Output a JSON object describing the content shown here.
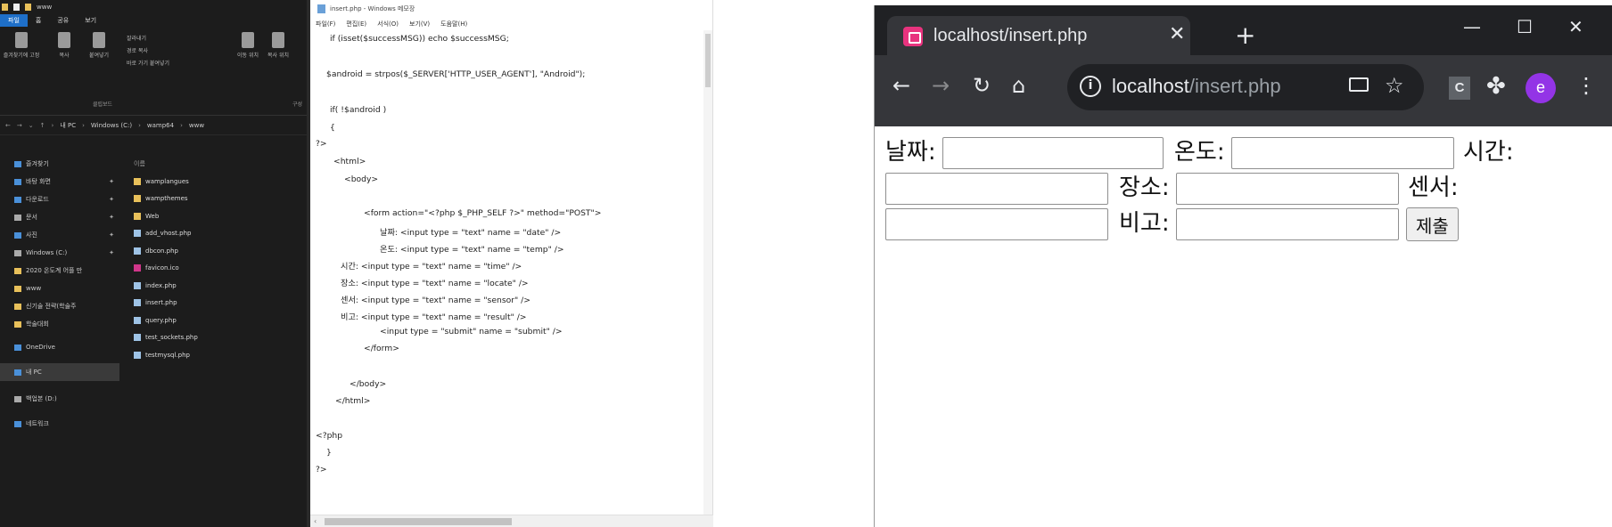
{
  "explorer": {
    "window_title": "www",
    "ribbon_tabs": [
      "파일",
      "홈",
      "공유",
      "보기"
    ],
    "ribbon": {
      "pin_label": "즐겨찾기에 고정",
      "copy_label": "복사",
      "paste_label": "붙여넣기",
      "cut_label": "잘라내기",
      "copy_path_label": "경로 복사",
      "paste_shortcut_label": "바로 가기 붙여넣기",
      "move_label": "이동 위치",
      "copy_to_label": "복사 위치",
      "clipboard_group": "클립보드",
      "organize_group": "구성"
    },
    "address": {
      "segments": [
        "내 PC",
        "Windows (C:)",
        "wamp64",
        "www"
      ]
    },
    "nav_items": [
      {
        "label": "즐겨찾기",
        "icon": "star-icon",
        "pinned": false
      },
      {
        "label": "바탕 화면",
        "icon": "desktop-icon",
        "pinned": true
      },
      {
        "label": "다운로드",
        "icon": "download-icon",
        "pinned": true
      },
      {
        "label": "문서",
        "icon": "document-icon",
        "pinned": true
      },
      {
        "label": "사진",
        "icon": "pictures-icon",
        "pinned": true
      },
      {
        "label": "Windows (C:)",
        "icon": "drive-icon",
        "pinned": true
      },
      {
        "label": "2020 온도계 어플 만",
        "icon": "folder-icon",
        "pinned": false
      },
      {
        "label": "www",
        "icon": "folder-icon",
        "pinned": false
      },
      {
        "label": "신기술 전략(학술주",
        "icon": "folder-icon",
        "pinned": false
      },
      {
        "label": "학술대회",
        "icon": "folder-icon",
        "pinned": false
      },
      {
        "label": "OneDrive",
        "icon": "cloud-icon",
        "pinned": false
      },
      {
        "label": "내 PC",
        "icon": "pc-icon",
        "pinned": false
      },
      {
        "label": "백업본 (D:)",
        "icon": "drive-icon",
        "pinned": false
      },
      {
        "label": "네트워크",
        "icon": "network-icon",
        "pinned": false
      }
    ],
    "files_header": "이름",
    "files": [
      {
        "name": "wamplangues",
        "type": "folder"
      },
      {
        "name": "wampthemes",
        "type": "folder"
      },
      {
        "name": "Web",
        "type": "folder"
      },
      {
        "name": "add_vhost.php",
        "type": "php"
      },
      {
        "name": "dbcon.php",
        "type": "php"
      },
      {
        "name": "favicon.ico",
        "type": "ico"
      },
      {
        "name": "index.php",
        "type": "php"
      },
      {
        "name": "insert.php",
        "type": "php"
      },
      {
        "name": "query.php",
        "type": "php"
      },
      {
        "name": "test_sockets.php",
        "type": "php"
      },
      {
        "name": "testmysql.php",
        "type": "php"
      }
    ]
  },
  "notepad": {
    "title": "insert.php - Windows 메모장",
    "menu": [
      "파일(F)",
      "편집(E)",
      "서식(O)",
      "보기(V)",
      "도움말(H)"
    ],
    "lines": [
      "if (isset($successMSG)) echo $successMSG;",
      "",
      "$android = strpos($_SERVER['HTTP_USER_AGENT'], \"Android\");",
      "",
      "if( !$android )",
      "{",
      "?>",
      "<html>",
      "<body>",
      "",
      "<form action=\"<?php $_PHP_SELF ?>\" method=\"POST\">",
      "날짜: <input type = \"text\" name = \"date\" />",
      "온도: <input type = \"text\" name = \"temp\" />",
      "시간: <input type = \"text\" name = \"time\" />",
      "장소: <input type = \"text\" name = \"locate\" />",
      "센서: <input type = \"text\" name = \"sensor\" />",
      "비고: <input type = \"text\" name = \"result\" />",
      "<input type = \"submit\" name = \"submit\" />",
      "</form>",
      "",
      "</body>",
      "</html>",
      "",
      "<?php",
      "}",
      "?>"
    ]
  },
  "browser": {
    "tab_title": "localhost/insert.php",
    "new_tab_symbol": "+",
    "url_host": "localhost",
    "url_path": "/insert.php",
    "extension_letter": "C",
    "profile_letter": "e",
    "form": {
      "date_label": "날짜:",
      "temp_label": "온도:",
      "time_label": "시간:",
      "locate_label": "장소:",
      "sensor_label": "센서:",
      "result_label": "비고:",
      "submit_label": "제출",
      "date_value": "",
      "temp_value": "",
      "time_value": "",
      "locate_value": "",
      "sensor_value": "",
      "result_value": ""
    }
  },
  "colors": {
    "chrome_dark": "#202124",
    "chrome_toolbar": "#35363a",
    "explorer_bg": "#1c1c1c",
    "explorer_accent": "#1e6fc8",
    "tab_favicon": "#e8337e",
    "profile_avatar": "#9334e6"
  }
}
